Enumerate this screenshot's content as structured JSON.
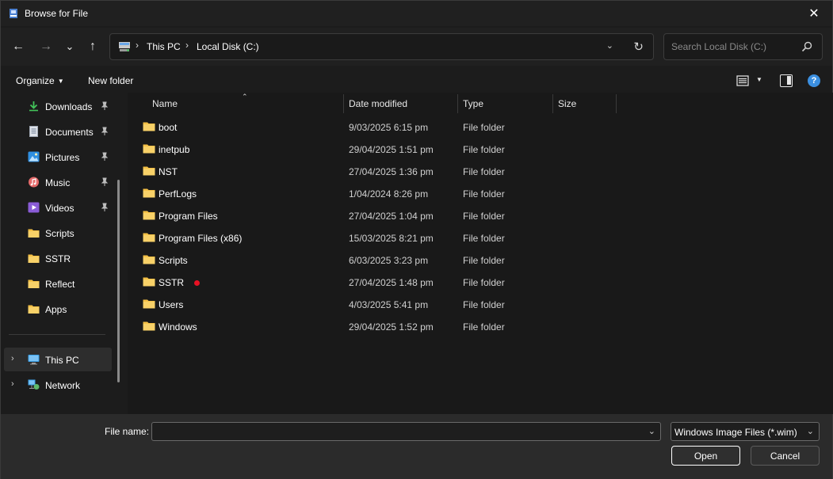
{
  "window": {
    "title": "Browse for File",
    "close_glyph": "✕"
  },
  "nav": {
    "back_glyph": "←",
    "forward_glyph": "→",
    "recent_glyph": "⌄",
    "up_glyph": "↑",
    "breadcrumb": [
      "This PC",
      "Local Disk (C:)"
    ],
    "sep_glyph": "›",
    "dropdown_glyph": "⌄",
    "refresh_glyph": "↻",
    "search_placeholder": "Search Local Disk (C:)"
  },
  "toolbar": {
    "organize": "Organize",
    "organize_caret": "▼",
    "new_folder": "New folder",
    "view_caret": "▼",
    "help": "?"
  },
  "sidebar": {
    "quick_access": [
      {
        "label": "Downloads",
        "icon": "download-icon",
        "pinned": true
      },
      {
        "label": "Documents",
        "icon": "document-icon",
        "pinned": true
      },
      {
        "label": "Pictures",
        "icon": "pictures-icon",
        "pinned": true
      },
      {
        "label": "Music",
        "icon": "music-icon",
        "pinned": true
      },
      {
        "label": "Videos",
        "icon": "videos-icon",
        "pinned": true
      },
      {
        "label": "Scripts",
        "icon": "folder-icon",
        "pinned": false
      },
      {
        "label": "SSTR",
        "icon": "folder-icon",
        "pinned": false
      },
      {
        "label": "Reflect",
        "icon": "folder-icon",
        "pinned": false
      },
      {
        "label": "Apps",
        "icon": "folder-icon",
        "pinned": false
      }
    ],
    "locations": [
      {
        "label": "This PC",
        "icon": "this-pc-icon",
        "selected": true
      },
      {
        "label": "Network",
        "icon": "network-icon",
        "selected": false
      }
    ],
    "expand_glyph": "›"
  },
  "list": {
    "columns": [
      "Name",
      "Date modified",
      "Type",
      "Size"
    ],
    "sort_glyph": "⌃",
    "rows": [
      {
        "name": "boot",
        "date": "9/03/2025 6:15 pm",
        "type": "File folder"
      },
      {
        "name": "inetpub",
        "date": "29/04/2025 1:51 pm",
        "type": "File folder"
      },
      {
        "name": "NST",
        "date": "27/04/2025 1:36 pm",
        "type": "File folder"
      },
      {
        "name": "PerfLogs",
        "date": "1/04/2024 8:26 pm",
        "type": "File folder"
      },
      {
        "name": "Program Files",
        "date": "27/04/2025 1:04 pm",
        "type": "File folder"
      },
      {
        "name": "Program Files (x86)",
        "date": "15/03/2025 8:21 pm",
        "type": "File folder"
      },
      {
        "name": "Scripts",
        "date": "6/03/2025 3:23 pm",
        "type": "File folder"
      },
      {
        "name": "SSTR",
        "date": "27/04/2025 1:48 pm",
        "type": "File folder"
      },
      {
        "name": "Users",
        "date": "4/03/2025 5:41 pm",
        "type": "File folder"
      },
      {
        "name": "Windows",
        "date": "29/04/2025 1:52 pm",
        "type": "File folder"
      }
    ]
  },
  "footer": {
    "file_name_label": "File name:",
    "file_name_value": "",
    "dropdown_glyph": "⌄",
    "file_type": "Windows Image Files (*.wim)",
    "open": "Open",
    "cancel": "Cancel"
  },
  "colors": {
    "folder": "#f4c045",
    "accent": "#3b8fe0",
    "status_dot": "#e81123"
  }
}
